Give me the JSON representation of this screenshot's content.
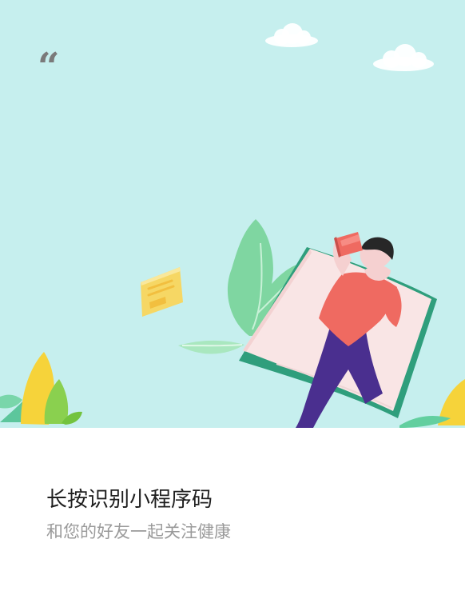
{
  "hero": {
    "quote_mark": "“",
    "background_color": "#c6efee"
  },
  "footer": {
    "title": "长按识别小程序码",
    "subtitle": "和您的好友一起关注健康"
  },
  "colors": {
    "title": "#1f1f1f",
    "subtitle": "#9a9a9a",
    "shirt": "#ef6a61",
    "pants": "#4a2f8f",
    "book_page": "#f8e4e4",
    "book_cover": "#2f9e7c",
    "leaf_green": "#7fd6a1",
    "leaf_yellow": "#f6d33a"
  },
  "icons": [
    "quote-mark-icon",
    "cloud-icon",
    "note-card-icon",
    "leaf-icon",
    "book-icon"
  ]
}
